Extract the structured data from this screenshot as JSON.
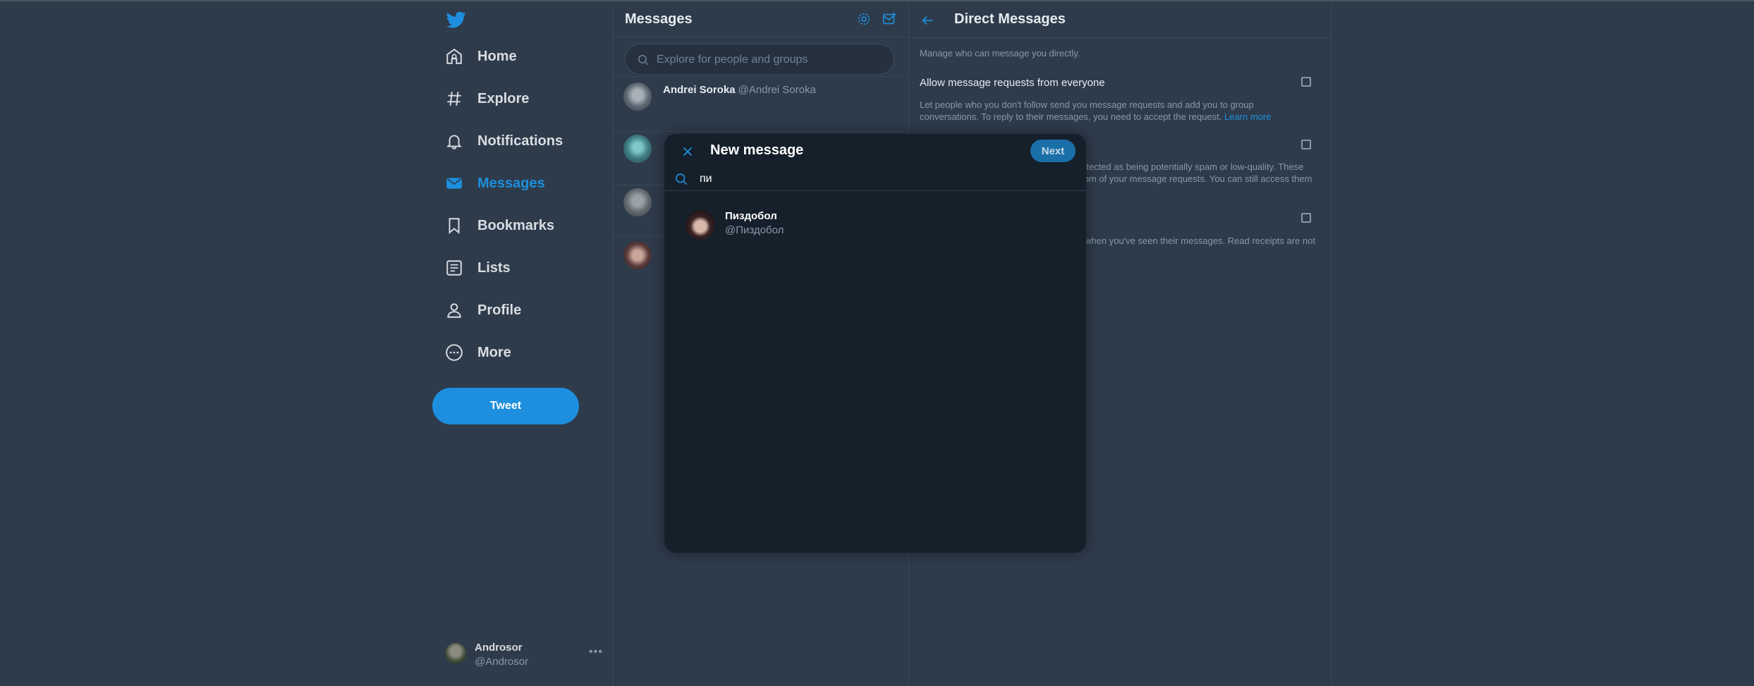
{
  "nav": {
    "items": [
      {
        "label": "Home",
        "icon": "home-icon"
      },
      {
        "label": "Explore",
        "icon": "hashtag-icon"
      },
      {
        "label": "Notifications",
        "icon": "bell-icon"
      },
      {
        "label": "Messages",
        "icon": "envelope-icon",
        "active": true
      },
      {
        "label": "Bookmarks",
        "icon": "bookmark-icon"
      },
      {
        "label": "Lists",
        "icon": "list-icon"
      },
      {
        "label": "Profile",
        "icon": "person-icon"
      },
      {
        "label": "More",
        "icon": "more-circle-icon"
      }
    ],
    "tweet_label": "Tweet",
    "account": {
      "name": "Androsor",
      "handle": "@Androsor"
    }
  },
  "messages": {
    "title": "Messages",
    "search_placeholder": "Explore for people and groups",
    "conversations": [
      {
        "name": "Andrei Soroka",
        "handle": "@Andrei Soroka"
      },
      {
        "name": "",
        "handle": ""
      },
      {
        "name": "",
        "handle": ""
      },
      {
        "name": "",
        "handle": ""
      }
    ]
  },
  "settings": {
    "title": "Direct Messages",
    "description": "Manage who can message you directly.",
    "allow_label": "Allow message requests from everyone",
    "allow_text": "Let people who you don't follow send you message requests and add you to group conversations. To reply to their messages, you need to accept the request.",
    "learn_more": "Learn more",
    "filter_text_1": "etected as being potentially spam or low-quality. These",
    "filter_text_2": "tom of your message requests. You can still access them",
    "receipts_text": "when you've seen their messages. Read receipts are not"
  },
  "modal": {
    "title": "New message",
    "next_label": "Next",
    "search_value": "пи",
    "result": {
      "name": "Пиздобол",
      "handle": "@Пиздобол"
    }
  },
  "colors": {
    "background": "#2e3b4b",
    "accent": "#1d8fde",
    "modal_bg": "#15202b",
    "overlay": "rgba(0,0,0,0.0)"
  }
}
